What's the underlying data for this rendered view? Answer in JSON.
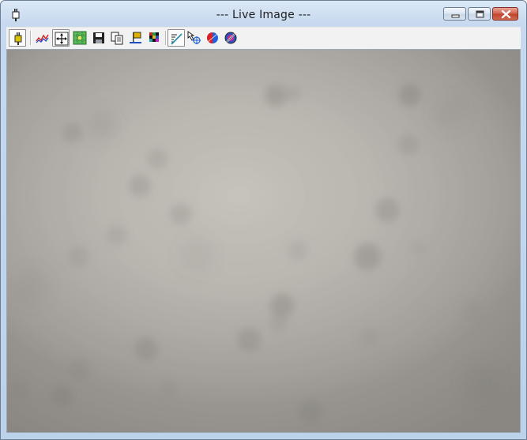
{
  "window": {
    "title": "--- Live Image ---",
    "app_icon": "camera-plug-icon",
    "controls": [
      "minimize-icon",
      "maximize-icon",
      "close-icon"
    ]
  },
  "toolbar": {
    "buttons": [
      {
        "icon": "camera-connect-icon",
        "pressed": true
      },
      {
        "icon": "histogram-icon",
        "pressed": false
      },
      {
        "icon": "fit-to-window-icon",
        "pressed": true
      },
      {
        "icon": "crosshair-grid-icon",
        "pressed": false
      },
      {
        "icon": "save-icon",
        "pressed": false
      },
      {
        "icon": "copy-icon",
        "pressed": false
      },
      {
        "icon": "flag-marker-icon",
        "pressed": false
      },
      {
        "icon": "color-palette-icon",
        "pressed": false
      },
      {
        "icon": "line-profile-icon",
        "pressed": true
      },
      {
        "icon": "pointer-target-icon",
        "pressed": false
      },
      {
        "icon": "color-balance-icon",
        "pressed": false
      },
      {
        "icon": "filter-wheel-icon",
        "pressed": false
      }
    ]
  },
  "colors": {
    "titlebar": "#c7d9ee",
    "toolbar_bg": "#f2f2f2",
    "image_base": "#bdb9b3",
    "close_button": "#c0412b"
  }
}
